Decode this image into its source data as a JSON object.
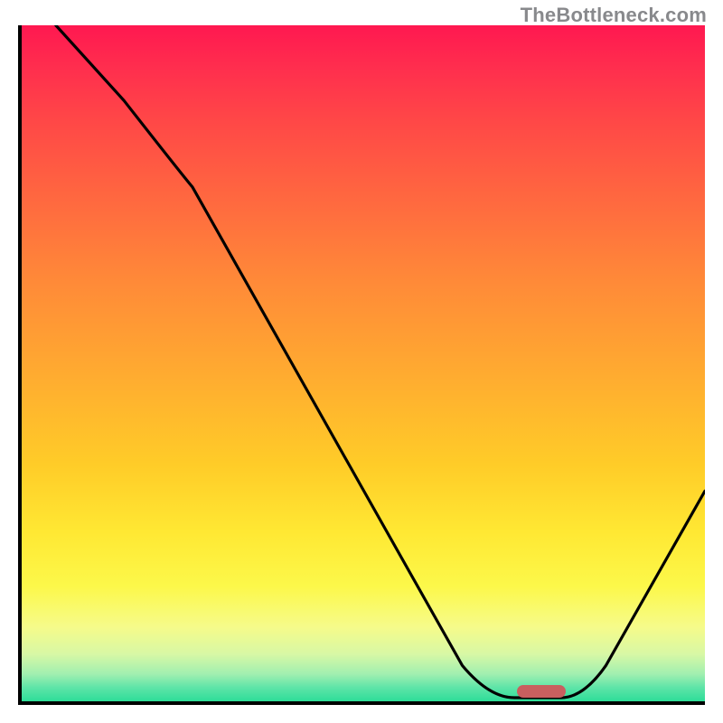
{
  "watermark": "TheBottleneck.com",
  "chart_data": {
    "type": "line",
    "title": "",
    "xlabel": "",
    "ylabel": "",
    "xlim": [
      0,
      100
    ],
    "ylim": [
      0,
      100
    ],
    "grid": false,
    "legend": false,
    "background_gradient": {
      "top_color": "#ff1850",
      "bottom_color": "#2ddd98",
      "description": "vertical gradient red (top) to green (bottom), indicating bottleneck severity"
    },
    "series": [
      {
        "name": "bottleneck-curve",
        "color": "#000000",
        "x": [
          5,
          10,
          15,
          20,
          25,
          30,
          35,
          40,
          45,
          50,
          55,
          60,
          65,
          70,
          75,
          80,
          85,
          90,
          95,
          100
        ],
        "y": [
          100,
          94,
          88,
          81,
          73,
          64,
          55,
          46,
          38,
          29,
          20,
          12,
          5,
          1,
          0,
          0,
          4,
          11,
          20,
          30
        ]
      }
    ],
    "marker": {
      "name": "optimal-range",
      "x_start": 73,
      "x_end": 80,
      "y": 0,
      "color": "#c95f5f"
    }
  }
}
